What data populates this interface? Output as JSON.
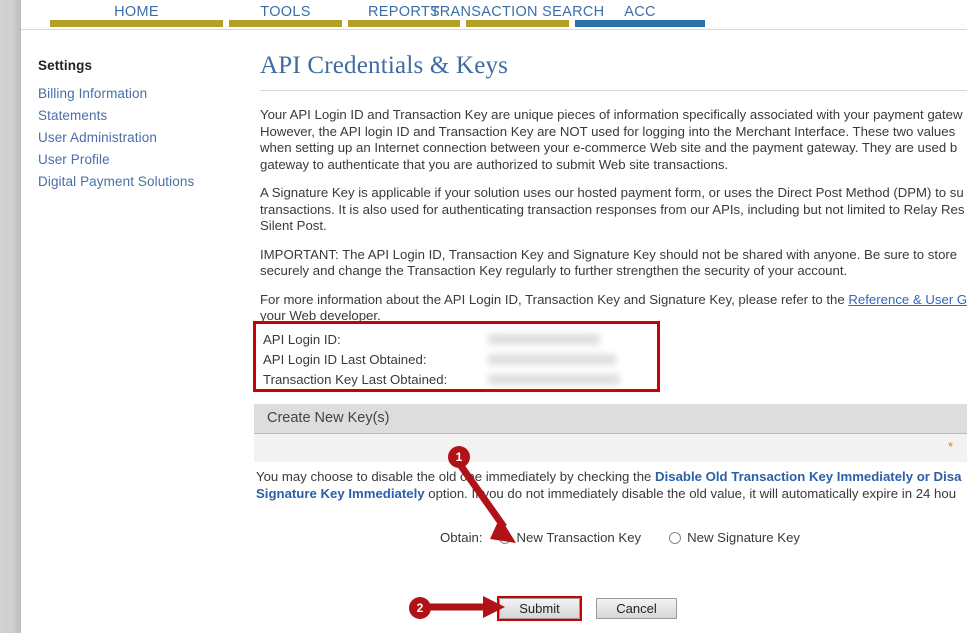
{
  "nav": {
    "tabs": [
      {
        "label": "HOME",
        "active": false
      },
      {
        "label": "TOOLS",
        "active": false
      },
      {
        "label": "REPORTS",
        "active": false
      },
      {
        "label": "TRANSACTION SEARCH",
        "active": false
      },
      {
        "label": "ACC",
        "active": true
      }
    ],
    "accent_inactive": "#b3a125",
    "accent_active": "#2b70a8"
  },
  "sidebar": {
    "title": "Settings",
    "items": [
      {
        "label": "Billing Information"
      },
      {
        "label": "Statements"
      },
      {
        "label": "User Administration"
      },
      {
        "label": "User Profile"
      },
      {
        "label": "Digital Payment Solutions"
      }
    ]
  },
  "main": {
    "page_title": "API Credentials & Keys",
    "paragraph1": {
      "line1": "Your API Login ID and Transaction Key are unique pieces of information specifically associated with your payment gatew",
      "line2": "However, the API login ID and Transaction Key are NOT used for logging into the Merchant Interface. These two values ",
      "line3": "when setting up an Internet connection between your e-commerce Web site and the payment gateway. They are used b",
      "line4": "gateway to authenticate that you are authorized to submit Web site transactions."
    },
    "paragraph2": {
      "line1": "A Signature Key is applicable if your solution uses our hosted payment form, or uses the Direct Post Method (DPM) to su",
      "line2": "transactions. It is also used for authenticating transaction responses from our APIs, including but not limited to Relay Res",
      "line3": "Silent Post."
    },
    "paragraph3": {
      "line1": "IMPORTANT: The API Login ID, Transaction Key and Signature Key should not be shared with anyone. Be sure to store",
      "line2": "securely and change the Transaction Key regularly to further strengthen the security of your account."
    },
    "paragraph4": {
      "line1_pre": "For more information about the API Login ID, Transaction Key and Signature Key, please refer to the ",
      "link_text": "Reference & User G",
      "line2": "your Web developer."
    }
  },
  "credentials": {
    "border_color": "#cc0000",
    "rows": [
      {
        "label": "API Login ID:",
        "value": ""
      },
      {
        "label": "API Login ID Last Obtained:",
        "value": ""
      },
      {
        "label": "Transaction Key Last Obtained:",
        "value": ""
      }
    ]
  },
  "create_keys": {
    "section_label": "Create New Key(s)",
    "required_mark": "*",
    "note": {
      "line1_a": "You may choose to disable the old one immediately by checking the ",
      "line1_b": "Disable Old Transaction Key Immediately or Disa",
      "line2_a": "Signature Key Immediately",
      "line2_b": " option. If you do not immediately disable the old value, it will automatically expire in 24 hou"
    },
    "obtain_label": "Obtain:",
    "options": [
      {
        "label": "New Transaction Key",
        "selected": false
      },
      {
        "label": "New Signature Key",
        "selected": false
      }
    ]
  },
  "buttons": {
    "submit": "Submit",
    "cancel": "Cancel"
  },
  "annotations": {
    "badge_color": "#b01217",
    "markers": [
      {
        "id": "1",
        "label": "1"
      },
      {
        "id": "2",
        "label": "2"
      }
    ]
  }
}
